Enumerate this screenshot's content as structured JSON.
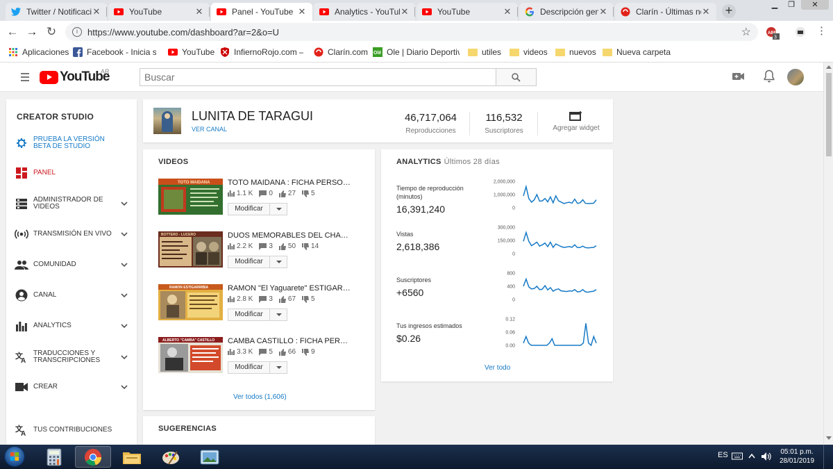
{
  "browser": {
    "tabs": [
      {
        "title": "Twitter / Notificaciones",
        "icon": "twitter-icon",
        "active": false
      },
      {
        "title": "YouTube",
        "icon": "youtube-icon",
        "active": false
      },
      {
        "title": "Panel - YouTube",
        "icon": "youtube-icon",
        "active": true
      },
      {
        "title": "Analytics - YouTube",
        "icon": "youtube-icon",
        "active": false
      },
      {
        "title": "YouTube",
        "icon": "youtube-icon",
        "active": false
      },
      {
        "title": "Descripción general",
        "icon": "google-icon",
        "active": false
      },
      {
        "title": "Clarín - Últimas noticias",
        "icon": "clarin-icon",
        "active": false
      }
    ],
    "url": "https://www.youtube.com/dashboard?ar=2&o=U",
    "bookmarks": [
      {
        "label": "Aplicaciones",
        "icon": "apps-grid-icon"
      },
      {
        "label": "Facebook - Inicia sesión",
        "icon": "facebook-icon"
      },
      {
        "label": "YouTube",
        "icon": "youtube-icon"
      },
      {
        "label": "InfiernoRojo.com – C",
        "icon": "shield-icon"
      },
      {
        "label": "Clarín.com",
        "icon": "clarin-icon"
      },
      {
        "label": "Ole | Diario Deportivo",
        "icon": "ole-icon"
      },
      {
        "label": "utiles",
        "icon": "folder-icon"
      },
      {
        "label": "videos",
        "icon": "folder-icon"
      },
      {
        "label": "nuevos",
        "icon": "folder-icon"
      },
      {
        "label": "Nueva carpeta",
        "icon": "folder-icon"
      }
    ],
    "extension_badge": "3"
  },
  "masthead": {
    "logo_text": "YouTube",
    "country": "AR",
    "search_placeholder": "Buscar"
  },
  "sidebar": {
    "title": "CREATOR STUDIO",
    "items": [
      {
        "label": "PRUEBA LA VERSIÓN BETA DE STUDIO",
        "icon": "gear-icon"
      },
      {
        "label": "PANEL",
        "icon": "dashboard-icon"
      },
      {
        "label": "ADMINISTRADOR DE VIDEOS",
        "icon": "video-manager-icon"
      },
      {
        "label": "TRANSMISIÓN EN VIVO",
        "icon": "live-icon"
      },
      {
        "label": "COMUNIDAD",
        "icon": "people-icon"
      },
      {
        "label": "CANAL",
        "icon": "account-icon"
      },
      {
        "label": "ANALYTICS",
        "icon": "bar-chart-icon"
      },
      {
        "label": "TRADUCCIONES Y TRANSCRIPCIONES",
        "icon": "translate-icon"
      },
      {
        "label": "CREAR",
        "icon": "camera-icon"
      },
      {
        "label": "TUS CONTRIBUCIONES",
        "icon": "translate-icon"
      }
    ]
  },
  "channel": {
    "name": "LUNITA DE TARAGUI",
    "view_link": "VER CANAL",
    "views_value": "46,717,064",
    "views_label": "Reproducciones",
    "subs_value": "116,532",
    "subs_label": "Suscriptores",
    "widget_label": "Agregar widget"
  },
  "videos": {
    "title": "VIDEOS",
    "button_label": "Modificar",
    "see_all": "Ver todos (1,606)",
    "items": [
      {
        "title": "TOTO MAIDANA : FICHA PERSONAL",
        "views": "1.1 K",
        "comments": "0",
        "likes": "27",
        "dislikes": "5",
        "thumb_caption": "TOTO MAIDANA"
      },
      {
        "title": "DUOS MEMORABLES DEL CHAMAMÉ",
        "views": "2.2 K",
        "comments": "3",
        "likes": "50",
        "dislikes": "14",
        "thumb_caption": "BOTTERO - LUCERO"
      },
      {
        "title": "RAMON \"El Yaguarete\" ESTIGARRIBIA",
        "views": "2.8 K",
        "comments": "3",
        "likes": "67",
        "dislikes": "5",
        "thumb_caption": "RAMON ESTIGARRIBIA"
      },
      {
        "title": "CAMBA CASTILLO : FICHA PERSONAL",
        "views": "3.3 K",
        "comments": "5",
        "likes": "66",
        "dislikes": "9",
        "thumb_caption": "ALBERTO \"CAMBA\" CASTILLO"
      }
    ]
  },
  "suggestions": {
    "title": "SUGERENCIAS"
  },
  "analytics": {
    "title": "ANALYTICS",
    "period": "Últimos 28 días",
    "see_all": "Ver todo",
    "metrics": [
      {
        "label": "Tiempo de reproducción (minutos)",
        "value": "16,391,240",
        "ticks": [
          "2,000,000",
          "1,000,000",
          "0"
        ],
        "ymax": 2000000,
        "series": [
          900000,
          1600000,
          700000,
          420000,
          600000,
          1000000,
          500000,
          520000,
          700000,
          450000,
          820000,
          380000,
          900000,
          520000,
          430000,
          320000,
          380000,
          420000,
          350000,
          650000,
          330000,
          380000,
          600000,
          330000,
          320000,
          330000,
          340000,
          600000
        ]
      },
      {
        "label": "Vistas",
        "value": "2,618,386",
        "ticks": [
          "300,000",
          "150,000",
          "0"
        ],
        "ymax": 300000,
        "series": [
          140000,
          240000,
          140000,
          90000,
          110000,
          130000,
          85000,
          100000,
          120000,
          80000,
          130000,
          70000,
          110000,
          95000,
          80000,
          70000,
          75000,
          80000,
          72000,
          100000,
          68000,
          70000,
          85000,
          68000,
          65000,
          68000,
          70000,
          90000
        ]
      },
      {
        "label": "Suscriptores",
        "value": "+6560",
        "ticks": [
          "800",
          "400",
          "0"
        ],
        "ymax": 800,
        "series": [
          400,
          620,
          380,
          320,
          330,
          400,
          300,
          310,
          420,
          290,
          360,
          250,
          300,
          320,
          260,
          250,
          240,
          260,
          250,
          300,
          230,
          240,
          300,
          230,
          220,
          240,
          250,
          300
        ]
      },
      {
        "label": "Tus ingresos estimados",
        "value": "$0.26",
        "ticks": [
          "0.12",
          "0.06",
          "0.00"
        ],
        "ymax": 0.12,
        "series": [
          0.01,
          0.04,
          0.01,
          0,
          0,
          0,
          0,
          0,
          0,
          0,
          0.01,
          0.03,
          0,
          0,
          0,
          0,
          0,
          0,
          0,
          0,
          0,
          0,
          0,
          0.01,
          0.1,
          0.01,
          0,
          0.04,
          0.01
        ]
      }
    ]
  },
  "taskbar": {
    "lang": "ES",
    "time": "05:01 p.m.",
    "date": "28/01/2019"
  }
}
